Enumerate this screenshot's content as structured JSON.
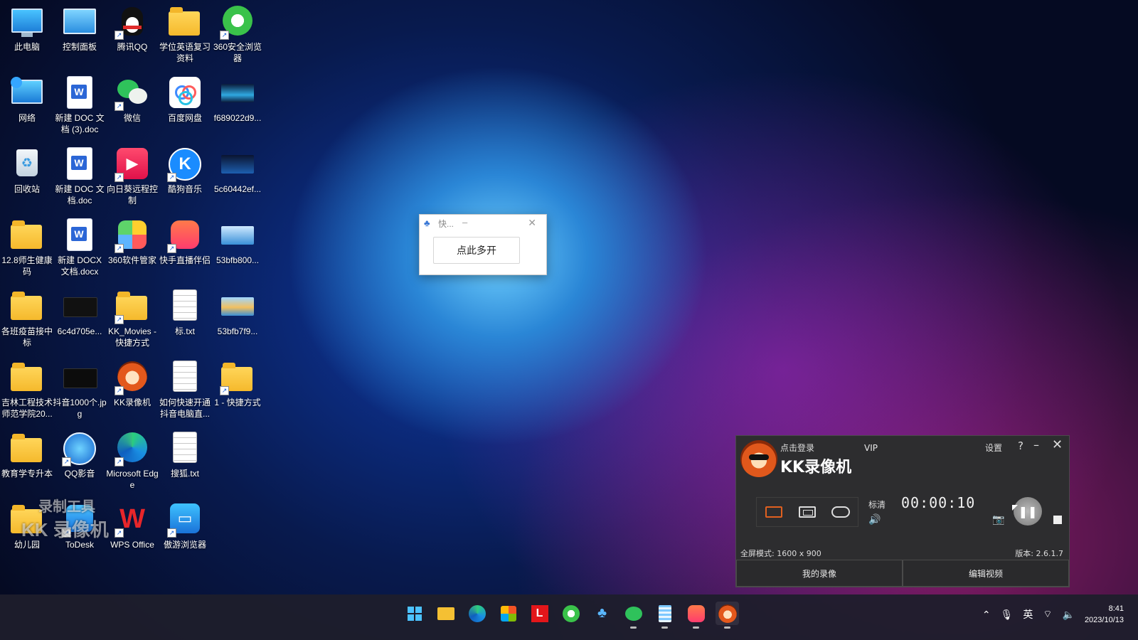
{
  "desktop": {
    "icons": [
      {
        "label": "此电脑"
      },
      {
        "label": "控制面板"
      },
      {
        "label": "腾讯QQ"
      },
      {
        "label": "学位英语复习资料"
      },
      {
        "label": "360安全浏览器"
      },
      {
        "label": "网络"
      },
      {
        "label": "新建 DOC 文档 (3).doc"
      },
      {
        "label": "微信"
      },
      {
        "label": "百度网盘"
      },
      {
        "label": "f689022d9..."
      },
      {
        "label": "回收站"
      },
      {
        "label": "新建 DOC 文档.doc"
      },
      {
        "label": "向日葵远程控制"
      },
      {
        "label": "酷狗音乐"
      },
      {
        "label": "5c60442ef..."
      },
      {
        "label": "12.8师生健康码"
      },
      {
        "label": "新建 DOCX 文档.docx"
      },
      {
        "label": "360软件管家"
      },
      {
        "label": "快手直播伴侣"
      },
      {
        "label": "53bfb800..."
      },
      {
        "label": "各班疫苗接中标"
      },
      {
        "label": "6c4d705e..."
      },
      {
        "label": "KK_Movies - 快捷方式"
      },
      {
        "label": "标.txt"
      },
      {
        "label": "53bfb7f9..."
      },
      {
        "label": "吉林工程技术师范学院20..."
      },
      {
        "label": "抖音1000个.jpg"
      },
      {
        "label": "KK录像机"
      },
      {
        "label": "如何快速开通抖音电脑直..."
      },
      {
        "label": "1 - 快捷方式"
      },
      {
        "label": "教育学专升本"
      },
      {
        "label": "QQ影音"
      },
      {
        "label": "Microsoft Edge"
      },
      {
        "label": "搜狐.txt"
      },
      {
        "label": "幼儿园"
      },
      {
        "label": "ToDesk"
      },
      {
        "label": "WPS Office"
      },
      {
        "label": "傲游浏览器"
      }
    ]
  },
  "dialog": {
    "title": "快...",
    "minimize": "–",
    "close": "✕",
    "button_label": "点此多开"
  },
  "watermark": {
    "line1": "录制工具",
    "line2": "KK 录像机"
  },
  "kk": {
    "login": "点击登录",
    "vip": "VIP",
    "title": "KK录像机",
    "settings": "设置",
    "help": "?",
    "minimize": "–",
    "close": "✕",
    "quality": "标清",
    "timer": "00:00:10",
    "mode_info": "全屏模式: 1600 x 900",
    "version": "版本: 2.6.1.7",
    "my_recordings": "我的录像",
    "edit_video": "编辑视频"
  },
  "taskbar": {
    "ime": "英",
    "time": "8:41",
    "date": "2023/10/13"
  }
}
